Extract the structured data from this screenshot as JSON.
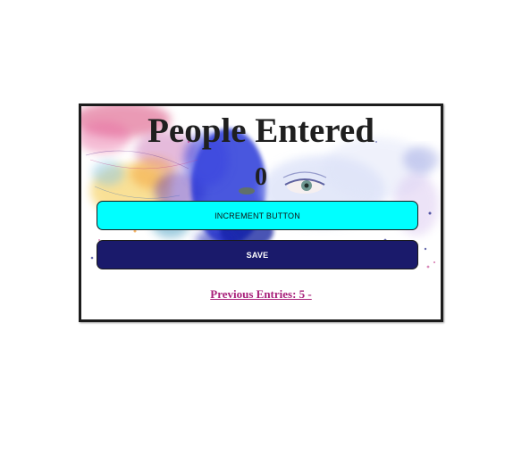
{
  "page": {
    "title": "People Entered",
    "counter_value": "0"
  },
  "buttons": {
    "increment_label": "INCREMENT BUTTON",
    "save_label": "SAVE"
  },
  "links": {
    "previous_entries": "Previous Entries: 5 -"
  },
  "background": {
    "image": "watercolor-face-art"
  },
  "colors": {
    "increment_button": "#00ffff",
    "save_button": "#1a1a6b",
    "link": "#a8207a",
    "title": "#1f1f1f"
  }
}
